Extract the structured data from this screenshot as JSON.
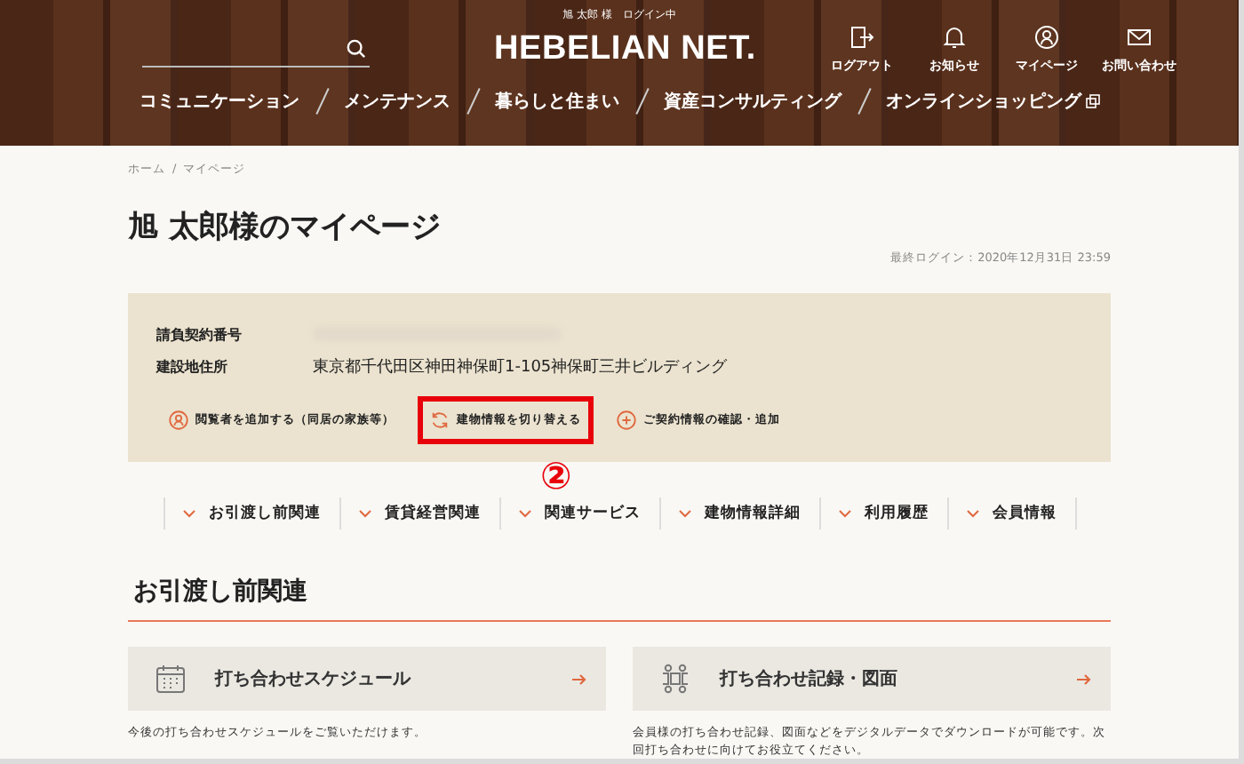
{
  "header": {
    "login_status": "旭 太郎 様　ログイン中",
    "logo": "HEBELIAN NET.",
    "icon_links": [
      {
        "label": "ログアウト",
        "kind": "logout"
      },
      {
        "label": "お知らせ",
        "kind": "bell"
      },
      {
        "label": "マイページ",
        "kind": "person"
      },
      {
        "label": "お問い合わせ",
        "kind": "mail"
      }
    ],
    "nav": [
      {
        "label": "コミュニケーション",
        "external": false
      },
      {
        "label": "メンテナンス",
        "external": false
      },
      {
        "label": "暮らしと住まい",
        "external": false
      },
      {
        "label": "資産コンサルティング",
        "external": false
      },
      {
        "label": "オンラインショッピング",
        "external": true
      }
    ]
  },
  "breadcrumb": {
    "items": [
      "ホーム",
      "マイページ"
    ],
    "separator": "/"
  },
  "page_title": "旭 太郎様のマイページ",
  "last_login": "最終ログイン：2020年12月31日 23:59",
  "contract": {
    "fields": [
      {
        "label": "請負契約番号",
        "blurred": true
      },
      {
        "label": "建設地住所",
        "value": "東京都千代田区神田神保町1-105神保町三井ビルディング",
        "blurred": false
      }
    ],
    "actions": [
      {
        "label": "閲覧者を追加する（同居の家族等）",
        "kind": "person",
        "highlighted": false
      },
      {
        "label": "建物情報を切り替える",
        "kind": "refresh",
        "highlighted": true
      },
      {
        "label": "ご契約情報の確認・追加",
        "kind": "plus",
        "highlighted": false
      }
    ],
    "annotation": "②"
  },
  "tabs": [
    "お引渡し前関連",
    "賃貸経営関連",
    "関連サービス",
    "建物情報詳細",
    "利用履歴",
    "会員情報"
  ],
  "section": {
    "title": "お引渡し前関連",
    "cards": [
      {
        "title": "打ち合わせスケジュール",
        "kind": "calendar",
        "description": "今後の打ち合わせスケジュールをご覧いただけます。"
      },
      {
        "title": "打ち合わせ記録・図面",
        "kind": "meeting",
        "description": "会員様の打ち合わせ記録、図面などをデジタルデータでダウンロードが可能です。次回打ち合わせに向けてお役立てください。"
      }
    ]
  }
}
